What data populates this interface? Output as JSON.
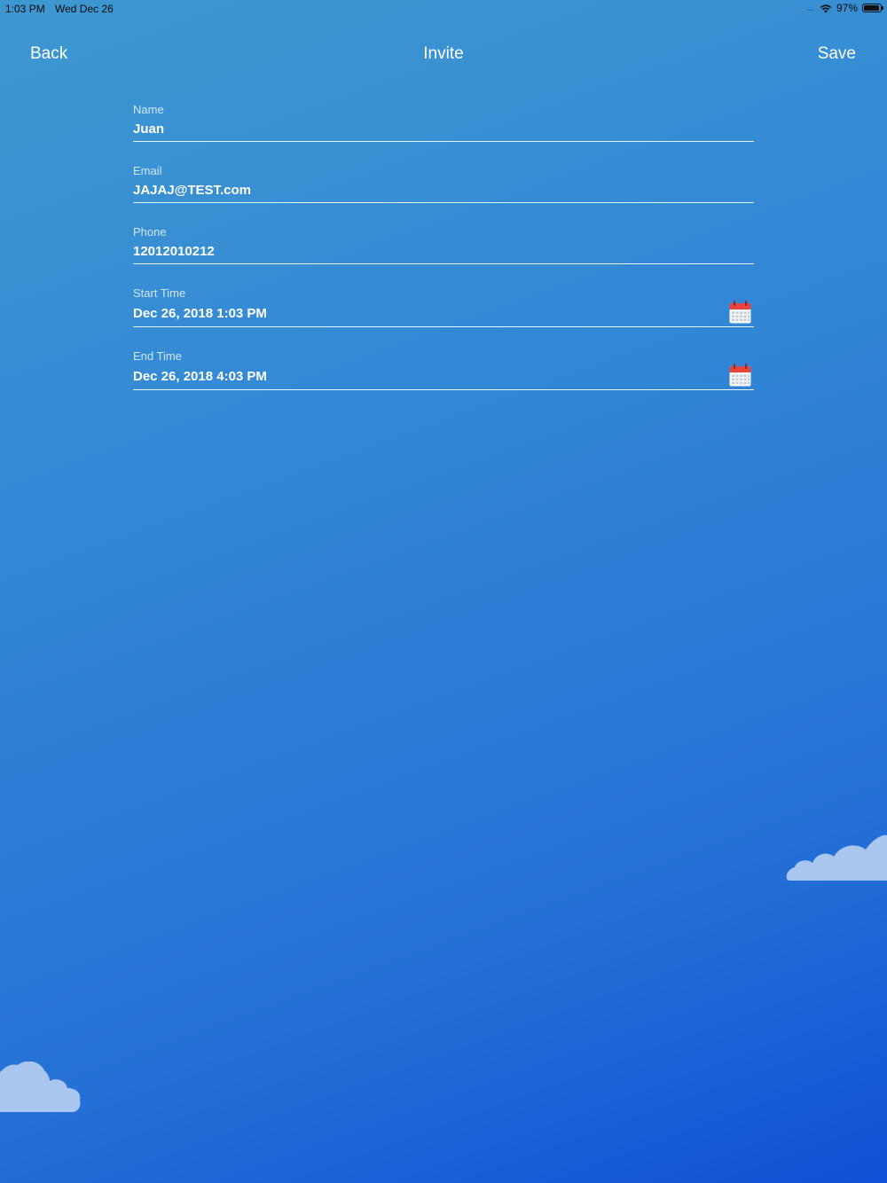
{
  "status_bar": {
    "time": "1:03 PM",
    "date": "Wed Dec 26",
    "battery": "97%",
    "battery_level": 0.97
  },
  "nav": {
    "back_label": "Back",
    "title": "Invite",
    "save_label": "Save"
  },
  "form": {
    "name": {
      "label": "Name",
      "value": "Juan"
    },
    "email": {
      "label": "Email",
      "value": "JAJAJ@TEST.com"
    },
    "phone": {
      "label": "Phone",
      "value": "12012010212"
    },
    "start_time": {
      "label": "Start Time",
      "value": "Dec 26, 2018 1:03 PM",
      "icon": "calendar-icon"
    },
    "end_time": {
      "label": "End Time",
      "value": "Dec 26, 2018 4:03 PM",
      "icon": "calendar-icon"
    }
  },
  "colors": {
    "background_top": "#3e98d0",
    "background_bottom": "#1150d6",
    "calendar_red": "#e8453c",
    "cloud": "#a9c6ee"
  }
}
